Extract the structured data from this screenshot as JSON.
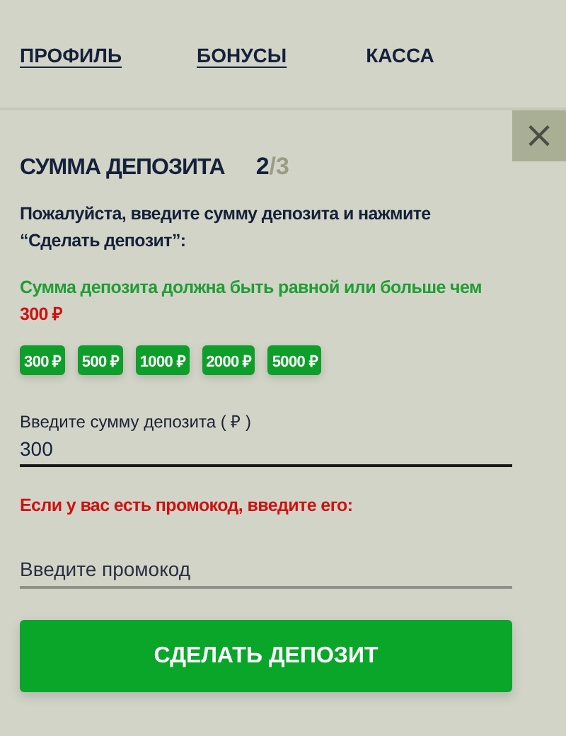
{
  "nav": [
    {
      "label": "ПРОФИЛЬ",
      "selected": false
    },
    {
      "label": "БОНУСЫ",
      "selected": false
    },
    {
      "label": "КАССА",
      "selected": true
    }
  ],
  "panel": {
    "title": "СУММА ДЕПОЗИТА",
    "step_current": "2",
    "step_total": "/3",
    "close": "×",
    "instruction": "Пожалуйста, введите сумму депозита и нажмите “Сделать депозит”:",
    "minimum_note": "Сумма депозита должна быть равной или больше чем",
    "minimum_amount": "300 ₽",
    "amounts": [
      "300 ₽",
      "500 ₽",
      "1000 ₽",
      "2000 ₽",
      "5000 ₽"
    ],
    "amount_field": {
      "label": "Введите сумму депозита ( ₽ )",
      "value": "300"
    },
    "promo_note": "Если у вас есть промокод, введите его:",
    "promo_field": {
      "placeholder": "Введите промокод"
    },
    "submit": "СДЕЛАТЬ ДЕПОЗИТ"
  }
}
